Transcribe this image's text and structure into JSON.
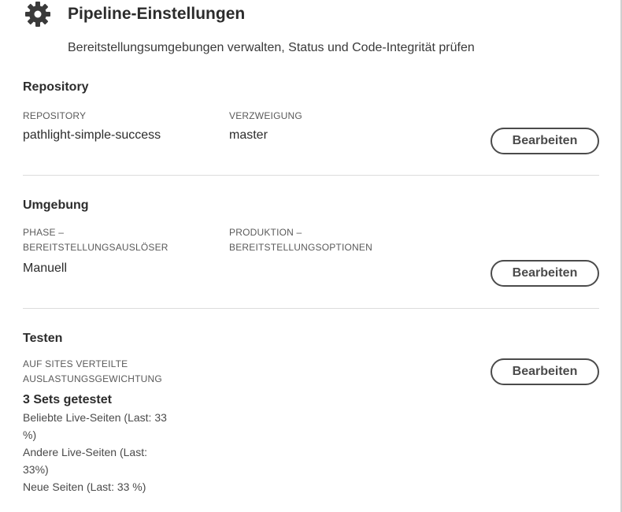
{
  "header": {
    "title": "Pipeline-Einstellungen",
    "subtitle": "Bereitstellungsumgebungen verwalten, Status und Code-Integrität prüfen",
    "icon": "gear-icon"
  },
  "repository_section": {
    "title": "Repository",
    "repo_label": "REPOSITORY",
    "repo_value": "pathlight-simple-success",
    "branch_label": "VERZWEIGUNG",
    "branch_value": "master",
    "edit_label": "Bearbeiten"
  },
  "environment_section": {
    "title": "Umgebung",
    "phase_label_1": "PHASE –",
    "phase_label_2": "BEREITSTELLUNGSAUSLÖSER",
    "phase_value": "Manuell",
    "production_label_1": "PRODUKTION –",
    "production_label_2": "BEREITSTELLUNGSOPTIONEN",
    "edit_label": "Bearbeiten"
  },
  "testing_section": {
    "title": "Testen",
    "weight_label_1": "AUF SITES VERTEILTE",
    "weight_label_2": "AUSLASTUNGSGEWICHTUNG",
    "sets_count": "3 Sets getestet",
    "sets": [
      {
        "line1": "Beliebte Live-Seiten (Last: 33",
        "line2": "%)"
      },
      {
        "line1": "Andere Live-Seiten (Last:",
        "line2": "33%)"
      },
      {
        "line1": "Neue Seiten (Last: 33 %)",
        "line2": ""
      }
    ],
    "edit_label": "Bearbeiten"
  },
  "colors": {
    "text": "#2c2c2c",
    "button_border": "#4b4b4b",
    "divider": "#dcdcdc"
  }
}
